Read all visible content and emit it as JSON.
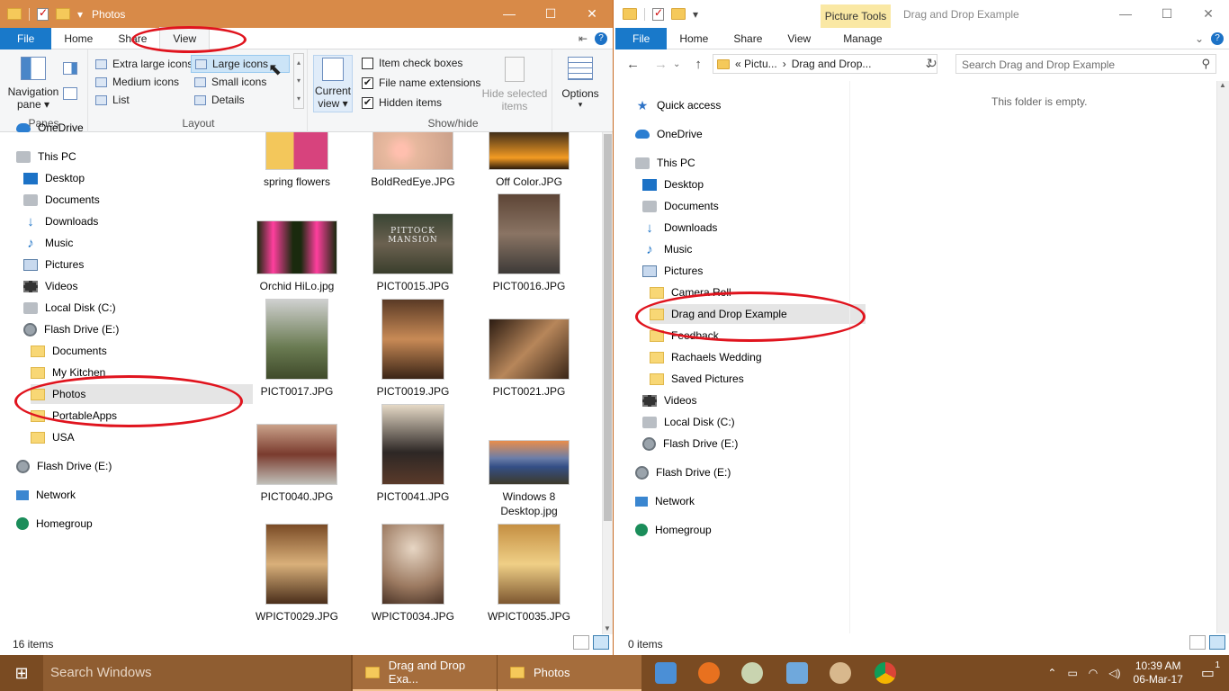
{
  "left": {
    "title": "Photos",
    "tabs": {
      "file": "File",
      "home": "Home",
      "share": "Share",
      "view": "View"
    },
    "ribbon": {
      "navigation_pane": "Navigation",
      "navigation_pane2": "pane",
      "panes_label": "Panes",
      "layout": {
        "extra_large": "Extra large icons",
        "large": "Large icons",
        "medium": "Medium icons",
        "small": "Small icons",
        "list": "List",
        "details": "Details",
        "label": "Layout"
      },
      "current_view": "Current",
      "current_view2": "view",
      "item_check_boxes": "Item check boxes",
      "file_name_extensions": "File name extensions",
      "hidden_items": "Hidden items",
      "hide_selected": "Hide selected",
      "hide_selected2": "items",
      "showhide_label": "Show/hide",
      "options": "Options"
    },
    "tree": [
      {
        "label": "OneDrive",
        "icon": "cloud"
      },
      {
        "label": "This PC",
        "icon": "pc"
      },
      {
        "label": "Desktop",
        "icon": "desktop"
      },
      {
        "label": "Documents",
        "icon": "documents"
      },
      {
        "label": "Downloads",
        "icon": "downloads"
      },
      {
        "label": "Music",
        "icon": "music"
      },
      {
        "label": "Pictures",
        "icon": "pictures"
      },
      {
        "label": "Videos",
        "icon": "videos"
      },
      {
        "label": "Local Disk (C:)",
        "icon": "drive"
      },
      {
        "label": "Flash Drive (E:)",
        "icon": "disk"
      },
      {
        "label": "Documents",
        "icon": "folder"
      },
      {
        "label": "My Kitchen",
        "icon": "folder"
      },
      {
        "label": "Photos",
        "icon": "folder"
      },
      {
        "label": "PortableApps",
        "icon": "folder"
      },
      {
        "label": "USA",
        "icon": "folder"
      },
      {
        "label": "Flash Drive (E:)",
        "icon": "disk"
      },
      {
        "label": "Network",
        "icon": "network"
      },
      {
        "label": "Homegroup",
        "icon": "homegroup"
      }
    ],
    "files": [
      {
        "name": "spring flowers"
      },
      {
        "name": "BoldRedEye.JPG"
      },
      {
        "name": "Off Color.JPG"
      },
      {
        "name": "Orchid HiLo.jpg"
      },
      {
        "name": "PICT0015.JPG"
      },
      {
        "name": "PICT0016.JPG"
      },
      {
        "name": "PICT0017.JPG"
      },
      {
        "name": "PICT0019.JPG"
      },
      {
        "name": "PICT0021.JPG"
      },
      {
        "name": "PICT0040.JPG"
      },
      {
        "name": "PICT0041.JPG"
      },
      {
        "name": "Windows 8",
        "name2": "Desktop.jpg"
      },
      {
        "name": "WPICT0029.JPG"
      },
      {
        "name": "WPICT0034.JPG"
      },
      {
        "name": "WPICT0035.JPG"
      }
    ],
    "pittock_text": "PITTOCK MANSION",
    "status": "16 items"
  },
  "right": {
    "title": "Drag and Drop Example",
    "picture_tools": "Picture Tools",
    "tabs": {
      "file": "File",
      "home": "Home",
      "share": "Share",
      "view": "View",
      "manage": "Manage"
    },
    "address": {
      "part1": "«  Pictu...",
      "part2": "Drag and Drop..."
    },
    "search_placeholder": "Search Drag and Drop Example",
    "empty_text": "This folder is empty.",
    "tree": [
      {
        "label": "Quick access",
        "icon": "star"
      },
      {
        "label": "OneDrive",
        "icon": "cloud"
      },
      {
        "label": "This PC",
        "icon": "pc"
      },
      {
        "label": "Desktop",
        "icon": "desktop"
      },
      {
        "label": "Documents",
        "icon": "documents"
      },
      {
        "label": "Downloads",
        "icon": "downloads"
      },
      {
        "label": "Music",
        "icon": "music"
      },
      {
        "label": "Pictures",
        "icon": "pictures"
      },
      {
        "label": "Camera Roll",
        "icon": "folder"
      },
      {
        "label": "Drag and Drop Example",
        "icon": "folder"
      },
      {
        "label": "Feedback",
        "icon": "folder"
      },
      {
        "label": "Rachaels Wedding",
        "icon": "folder"
      },
      {
        "label": "Saved Pictures",
        "icon": "folder"
      },
      {
        "label": "Videos",
        "icon": "videos"
      },
      {
        "label": "Local Disk (C:)",
        "icon": "drive"
      },
      {
        "label": "Flash Drive (E:)",
        "icon": "disk"
      },
      {
        "label": "Flash Drive (E:)",
        "icon": "disk"
      },
      {
        "label": "Network",
        "icon": "network"
      },
      {
        "label": "Homegroup",
        "icon": "homegroup"
      }
    ],
    "status": "0 items"
  },
  "taskbar": {
    "search": "Search Windows",
    "app1": "Drag and Drop Exa...",
    "app2": "Photos",
    "time": "10:39 AM",
    "date": "06-Mar-17",
    "notif_count": "1"
  },
  "colors": {
    "accent_left": "#d88a48",
    "taskbar": "#7a4b22",
    "file_tab": "#1979ca",
    "annotation": "#e0141e"
  }
}
